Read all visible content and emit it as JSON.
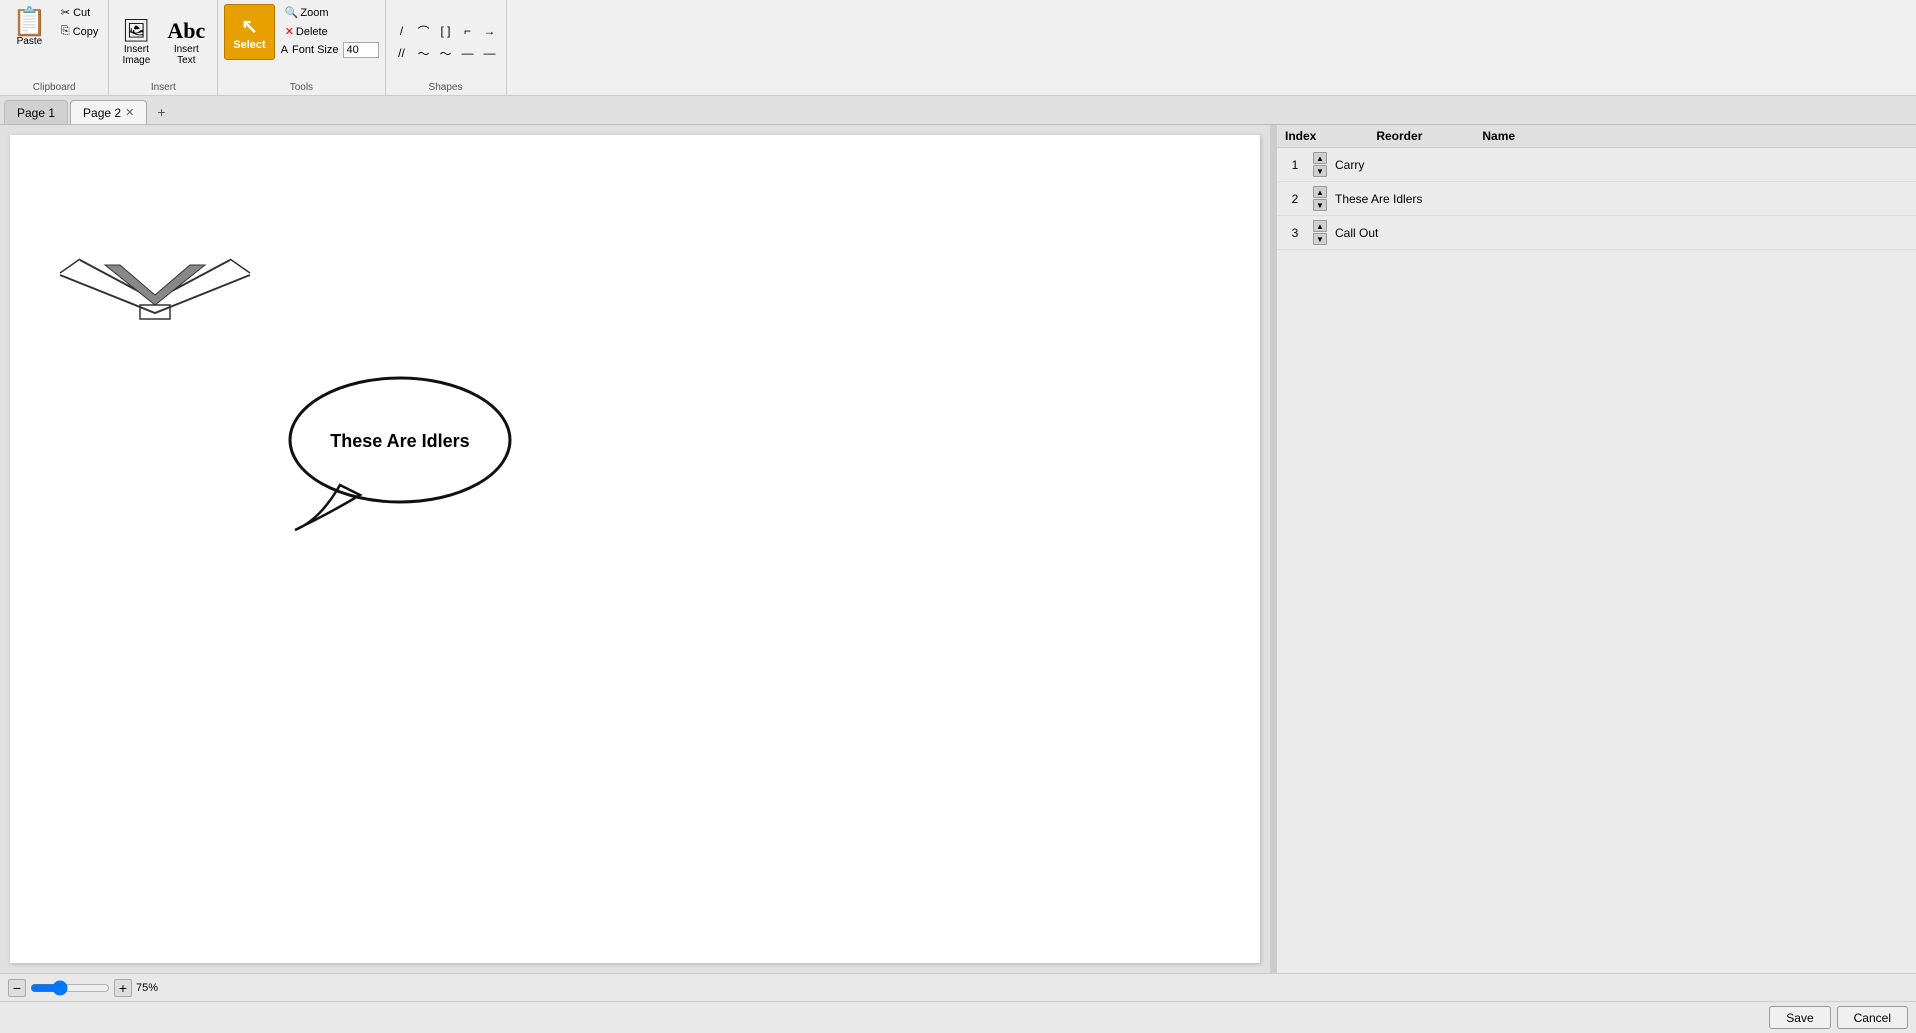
{
  "tabs": {
    "items": [
      {
        "label": "Page 1",
        "active": false,
        "closable": false
      },
      {
        "label": "Page 2",
        "active": true,
        "closable": true
      }
    ],
    "add_label": "+"
  },
  "toolbar": {
    "clipboard": {
      "label": "Clipboard",
      "paste_label": "Paste",
      "cut_label": "Cut",
      "copy_label": "Copy"
    },
    "insert": {
      "label": "Insert",
      "image_label": "Insert\nImage",
      "text_label": "Insert\nText"
    },
    "tools": {
      "label": "Tools",
      "select_label": "Select",
      "zoom_label": "Zoom",
      "delete_label": "Delete",
      "font_size_label": "Font Size",
      "font_size_value": "40"
    },
    "shapes": {
      "label": "Shapes",
      "items": [
        "╱",
        "⌒",
        "[ ]",
        "[ ]",
        "→",
        "//",
        "~",
        "~",
        "—",
        "—"
      ]
    }
  },
  "canvas": {
    "page_bg": "#ffffff",
    "callout_text": "These Are Idlers"
  },
  "layers": {
    "header": {
      "index_label": "Index",
      "reorder_label": "Reorder",
      "name_label": "Name"
    },
    "items": [
      {
        "index": "1",
        "name": "Carry"
      },
      {
        "index": "2",
        "name": "These Are Idlers"
      },
      {
        "index": "3",
        "name": "Call Out"
      }
    ]
  },
  "status": {
    "zoom_percent": "75%",
    "zoom_minus": "−",
    "zoom_plus": "+"
  },
  "footer": {
    "save_label": "Save",
    "cancel_label": "Cancel"
  }
}
